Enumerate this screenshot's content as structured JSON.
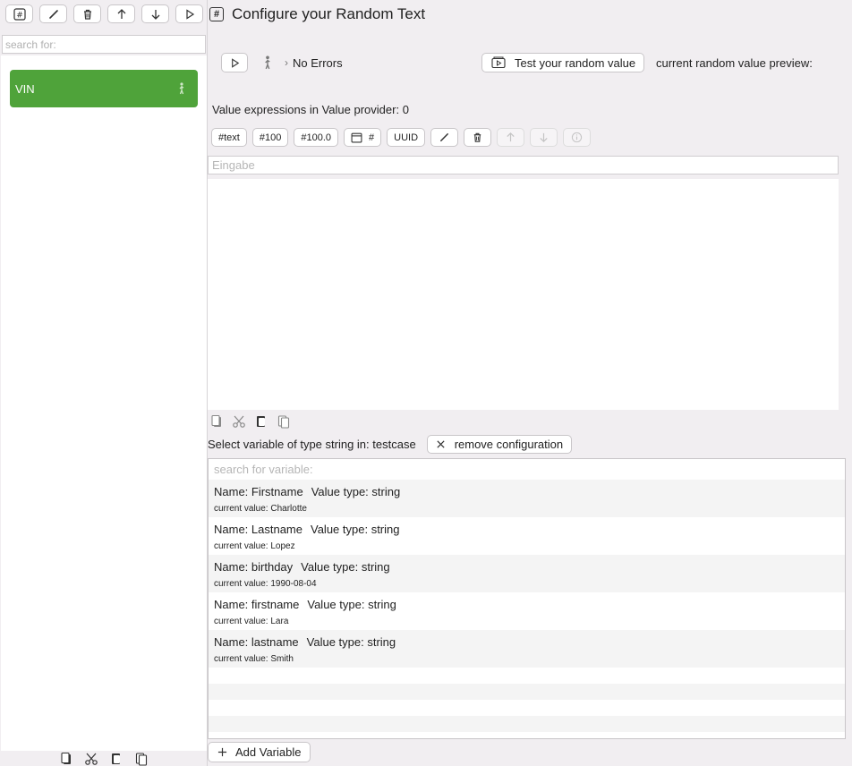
{
  "sidebar": {
    "search_placeholder": "search for:",
    "items": [
      {
        "label": "VIN",
        "color": "#4fa33a"
      }
    ]
  },
  "header": {
    "title": "Configure your Random Text"
  },
  "run": {
    "error_status": "No Errors",
    "test_button": "Test your random value",
    "preview_label": "current random value preview:"
  },
  "expressions": {
    "count_label": "Value expressions in Value provider: 0",
    "toolbar": [
      "#text",
      "#100",
      "#100.0",
      "#",
      "UUID"
    ],
    "input_placeholder": "Eingabe"
  },
  "variables": {
    "select_label": "Select variable of type string in: testcase",
    "remove_button": "remove configuration",
    "search_placeholder": "search for variable:",
    "items": [
      {
        "name": "Name: Firstname",
        "type": "Value type: string",
        "value": "current value: Charlotte"
      },
      {
        "name": "Name: Lastname",
        "type": "Value type: string",
        "value": "current value: Lopez"
      },
      {
        "name": "Name: birthday",
        "type": "Value type: string",
        "value": "current value: 1990-08-04"
      },
      {
        "name": "Name: firstname",
        "type": "Value type: string",
        "value": "current value: Lara"
      },
      {
        "name": "Name: lastname",
        "type": "Value type: string",
        "value": "current value: Smith"
      }
    ],
    "add_button": "Add Variable"
  }
}
